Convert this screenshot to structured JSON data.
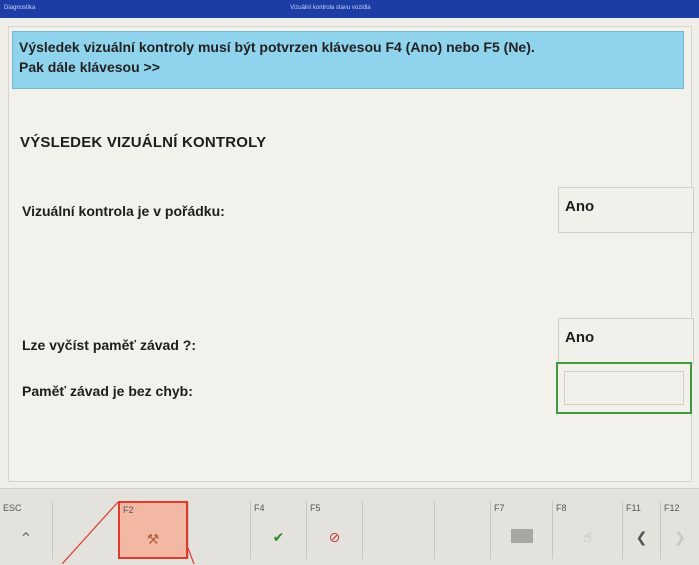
{
  "titlebar": {
    "left": "Diagnostika",
    "center": "Vizuální kontrola stavu vozidla"
  },
  "instruction": {
    "line1": "Výsledek vizuální kontroly musí být potvrzen klávesou F4 (Ano) nebo F5 (Ne).",
    "line2": "Pak dále klávesou >>"
  },
  "heading": "VÝSLEDEK VIZUÁLNÍ KONTROLY",
  "fields": [
    {
      "label": "Vizuální kontrola je v pořádku:",
      "value": "Ano"
    },
    {
      "label": "Lze vyčíst paměť závad ?:",
      "value": "Ano"
    },
    {
      "label": "Paměť závad je bez chyb:",
      "value": ""
    }
  ],
  "function_keys": [
    {
      "code": "ESC",
      "icon": "up-arrow-icon",
      "glyph": "⌃"
    },
    {
      "code": "F2",
      "icon": "tool-icon",
      "glyph": "⚒"
    },
    {
      "code": "F4",
      "icon": "check-icon",
      "glyph": "✔"
    },
    {
      "code": "F5",
      "icon": "cancel-icon",
      "glyph": "⊘"
    },
    {
      "code": "F7",
      "icon": "block-icon",
      "glyph": ""
    },
    {
      "code": "F8",
      "icon": "hand-icon",
      "glyph": "☝"
    },
    {
      "code": "F11",
      "icon": "back-icon",
      "glyph": "❮"
    },
    {
      "code": "F12",
      "icon": "forward-icon",
      "glyph": "❯"
    }
  ],
  "colors": {
    "instruction_bg": "#8fd3ec",
    "highlight_border": "#e23a2a",
    "focus_border": "#3f9b3f",
    "check": "#2e8b2e",
    "cancel": "#c53a3a"
  }
}
